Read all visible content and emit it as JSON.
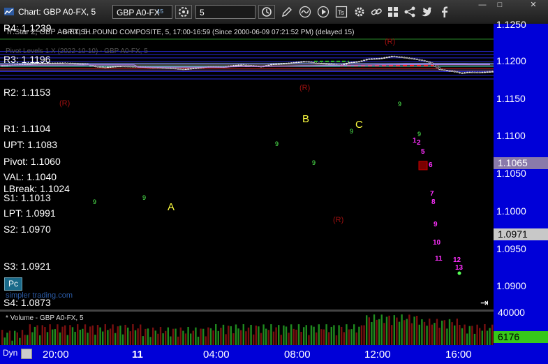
{
  "window": {
    "title": "Chart: GBP A0-FX, 5"
  },
  "toolbar": {
    "symbol": "GBP A0-FX",
    "symbol_superscript": "15",
    "interval": "5"
  },
  "header": {
    "study_line": "Tr:Star 2, GBP A0-FX, 5 ...",
    "series_line": "BRITISH POUND COMPOSITE, 5, 17:00-16:59 (Since 2000-06-09 07:21:52 PM) (delayed 15)",
    "study_line2": "Pivot Levels 1.X (2022-10-10) - GBP A0-FX, 5"
  },
  "levels": [
    {
      "id": "r4",
      "label": "R4: 1.1239"
    },
    {
      "id": "r3",
      "label": "R3: 1.1196"
    },
    {
      "id": "r2",
      "label": "R2: 1.1153"
    },
    {
      "id": "r1",
      "label": "R1: 1.1104"
    },
    {
      "id": "upt",
      "label": "UPT: 1.1083"
    },
    {
      "id": "pivot",
      "label": "Pivot: 1.1060"
    },
    {
      "id": "val",
      "label": "VAL: 1.1040"
    },
    {
      "id": "lbreak",
      "label": "LBreak: 1.1024"
    },
    {
      "id": "s1",
      "label": "S1: 1.1013"
    },
    {
      "id": "lpt",
      "label": "LPT: 1.0991"
    },
    {
      "id": "s2",
      "label": "S2: 1.0970"
    },
    {
      "id": "s3",
      "label": "S3: 1.0921"
    },
    {
      "id": "s4",
      "label": "S4: 1.0873"
    }
  ],
  "annotations": {
    "a": "A",
    "b": "B",
    "c": "C",
    "r_marker": "(R)",
    "pc_button": "Pc",
    "watermark": "simpler trading.com"
  },
  "price_axis": {
    "ticks": [
      "1.1250",
      "1.1200",
      "1.1150",
      "1.1100",
      "1.1050",
      "1.1000",
      "1.0950",
      "1.0900"
    ],
    "current_vwap": "1.1065",
    "current_price": "1.0971"
  },
  "volume": {
    "label": "* Volume - GBP A0-FX, 5",
    "axis_top": "40000",
    "current": "6176"
  },
  "time_axis": {
    "labels": [
      "20:00",
      "11",
      "04:00",
      "08:00",
      "12:00",
      "16:00"
    ],
    "dyn_label": "Dyn"
  },
  "colors": {
    "axis_blue": "#0000d8",
    "bull": "#ffffff",
    "bear": "#000000",
    "magenta": "#ff00ff",
    "green_count": "#55ff55",
    "vwap": "#b080e0",
    "red_dash": "#ff2020"
  },
  "tools": [
    "pencil-icon",
    "wave-icon",
    "play-icon",
    "tools-icon",
    "gear-icon",
    "link-icon",
    "grid-icon",
    "share-icon",
    "twitter-icon",
    "facebook-icon"
  ]
}
